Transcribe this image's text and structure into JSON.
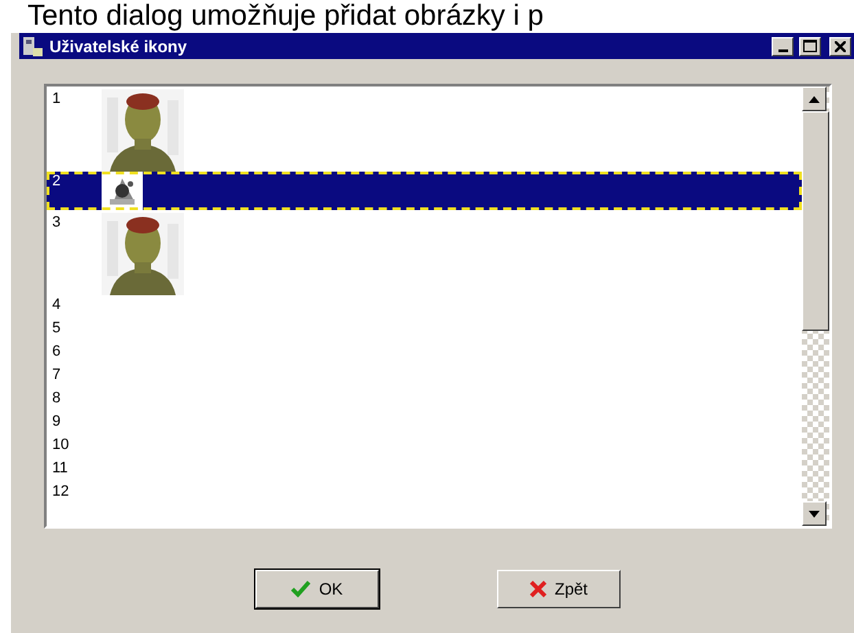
{
  "caption_text": "Tento dialog umožňuje přidat obrázky i p",
  "window": {
    "title": "Uživatelské ikony"
  },
  "list": {
    "items": [
      {
        "number": "1",
        "kind": "portrait",
        "selected": false
      },
      {
        "number": "2",
        "kind": "thumbnail",
        "selected": true
      },
      {
        "number": "3",
        "kind": "portrait",
        "selected": false
      },
      {
        "number": "4",
        "kind": "empty",
        "selected": false
      },
      {
        "number": "5",
        "kind": "empty",
        "selected": false
      },
      {
        "number": "6",
        "kind": "empty",
        "selected": false
      },
      {
        "number": "7",
        "kind": "empty",
        "selected": false
      },
      {
        "number": "8",
        "kind": "empty",
        "selected": false
      },
      {
        "number": "9",
        "kind": "empty",
        "selected": false
      },
      {
        "number": "10",
        "kind": "empty",
        "selected": false
      },
      {
        "number": "11",
        "kind": "empty",
        "selected": false
      },
      {
        "number": "12",
        "kind": "empty",
        "selected": false
      }
    ]
  },
  "buttons": [
    {
      "label": "OK",
      "kind": "ok"
    },
    {
      "label": "Zpět",
      "kind": "cancel"
    }
  ]
}
